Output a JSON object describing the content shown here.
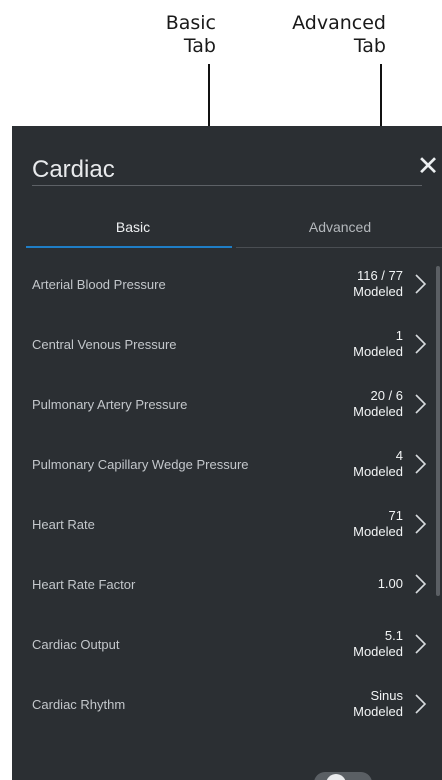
{
  "annotations": {
    "basic_tab_callout": "Basic\nTab",
    "advanced_tab_callout": "Advanced\nTab"
  },
  "panel": {
    "title": "Cardiac",
    "close_glyph": "✕",
    "tabs": [
      {
        "label": "Basic",
        "selected": true
      },
      {
        "label": "Advanced",
        "selected": false
      }
    ],
    "rows": [
      {
        "label": "Arterial Blood Pressure",
        "value": "116 / 77",
        "mode": "Modeled"
      },
      {
        "label": "Central Venous Pressure",
        "value": "1",
        "mode": "Modeled"
      },
      {
        "label": "Pulmonary Artery Pressure",
        "value": "20 / 6",
        "mode": "Modeled"
      },
      {
        "label": "Pulmonary Capillary Wedge Pressure",
        "value": "4",
        "mode": "Modeled"
      },
      {
        "label": "Heart Rate",
        "value": "71",
        "mode": "Modeled"
      },
      {
        "label": "Heart Rate Factor",
        "value": "1.00",
        "mode": ""
      },
      {
        "label": "Cardiac Output",
        "value": "5.1",
        "mode": "Modeled"
      },
      {
        "label": "Cardiac Rhythm",
        "value": "Sinus",
        "mode": "Modeled"
      }
    ]
  },
  "colors": {
    "panel_background": "#2b2f33",
    "accent_blue": "#1f7ec6"
  }
}
